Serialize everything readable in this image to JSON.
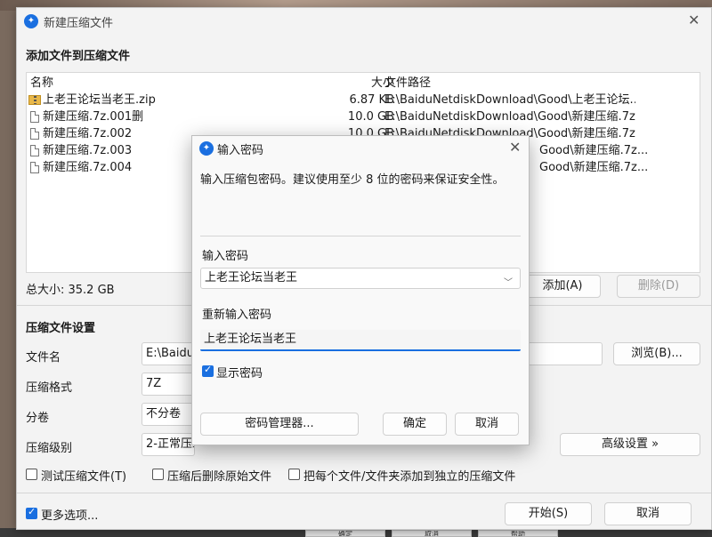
{
  "main": {
    "title": "新建压缩文件",
    "add_section_title": "添加文件到压缩文件",
    "list_headers": {
      "name": "名称",
      "size": "大小",
      "path": "文件路径"
    },
    "files": [
      {
        "name": "上老王论坛当老王.zip",
        "size": "6.87 KB",
        "path": "E:\\BaiduNetdiskDownload\\Good\\上老王论坛...",
        "icon": "zip-archive-icon"
      },
      {
        "name": "新建压缩.7z.001删",
        "size": "10.0 GB",
        "path": "E:\\BaiduNetdiskDownload\\Good\\新建压缩.7z...",
        "icon": "document-icon"
      },
      {
        "name": "新建压缩.7z.002",
        "size": "10.0 GB",
        "path": "E:\\BaiduNetdiskDownload\\Good\\新建压缩.7z...",
        "icon": "document-icon"
      },
      {
        "name": "新建压缩.7z.003",
        "size": "",
        "path": "Good\\新建压缩.7z...",
        "icon": "document-icon"
      },
      {
        "name": "新建压缩.7z.004",
        "size": "",
        "path": "Good\\新建压缩.7z...",
        "icon": "document-icon"
      }
    ],
    "total_size": "总大小: 35.2 GB",
    "add_button": "添加(A)",
    "delete_button": "删除(D)",
    "settings_title": "压缩文件设置",
    "filename_label": "文件名",
    "filename_value": "E:\\BaiduN",
    "browse_button": "浏览(B)...",
    "format_label": "压缩格式",
    "format_value": "7Z",
    "volume_label": "分卷",
    "volume_value": "不分卷",
    "level_label": "压缩级别",
    "level_value": "2-正常压缩",
    "advanced_button": "高级设置 »",
    "options": [
      {
        "label": "测试压缩文件(T)",
        "checked": false
      },
      {
        "label": "压缩后删除原始文件",
        "checked": false
      },
      {
        "label": "把每个文件/文件夹添加到独立的压缩文件",
        "checked": false
      }
    ],
    "more_options": {
      "label": "更多选项...",
      "checked": true
    },
    "start_button": "开始(S)",
    "cancel_button": "取消"
  },
  "dialog": {
    "title": "输入密码",
    "description": "输入压缩包密码。建议使用至少 8 位的密码来保证安全性。",
    "password_label": "输入密码",
    "password_value": "上老王论坛当老王",
    "reenter_label": "重新输入密码",
    "reenter_value": "上老王论坛当老王",
    "show_password": {
      "label": "显示密码",
      "checked": true
    },
    "manager_button": "密码管理器...",
    "ok_button": "确定",
    "cancel_button": "取消"
  },
  "background": {
    "buttons": [
      "确定",
      "取消",
      "帮助"
    ]
  },
  "colors": {
    "accent": "#1a6fe0",
    "zip": "#e9b84a"
  }
}
